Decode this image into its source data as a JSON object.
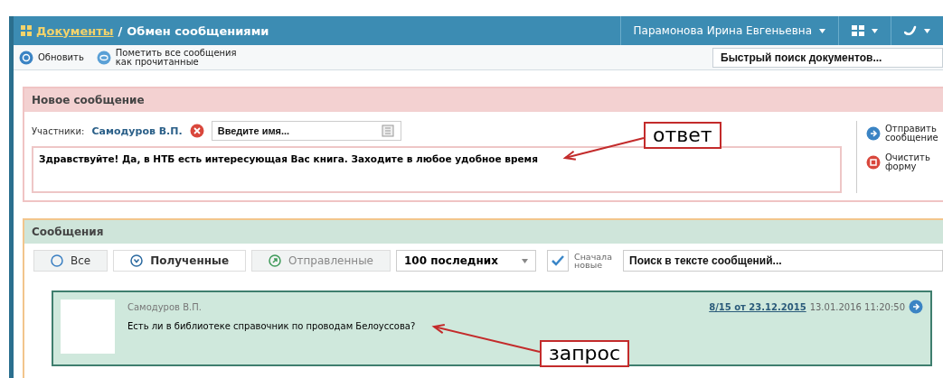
{
  "header": {
    "breadcrumb_link": "Документы",
    "separator": "/",
    "title": "Обмен сообщениями",
    "user": "Парамонова Ирина Евгеньевна"
  },
  "toolbar": {
    "refresh": "Обновить",
    "mark_read": "Пометить все сообщения\nкак прочитанные",
    "search": {
      "placeholder": "Быстрый поиск документов..."
    }
  },
  "new_message": {
    "title": "Новое сообщение",
    "participants_label": "Участники:",
    "participant": "Самодуров В.П.",
    "name_field": {
      "placeholder": "Введите имя..."
    },
    "text": "Здравствуйте! Да, в НТБ есть интересующая Вас книга. Заходите в любое удобное время",
    "send": "Отправить\nсообщение",
    "clear": "Очистить\nформу"
  },
  "messages": {
    "title": "Сообщения",
    "filters": [
      {
        "label": "Все",
        "kind": "all",
        "selected": false
      },
      {
        "label": "Полученные",
        "kind": "received",
        "selected": true
      },
      {
        "label": "Отправленные",
        "kind": "sent",
        "selected": false
      }
    ],
    "count_select": "100 последних",
    "newest_first": {
      "label": "Сначала\nновые",
      "checked": true
    },
    "search": {
      "placeholder": "Поиск в тексте сообщений..."
    },
    "items": [
      {
        "author": "Самодуров В.П.",
        "text": "Есть ли в библиотеке справочник по проводам Белоуссова?",
        "ref": "8/15 от 23.12.2015",
        "date": "13.01.2016 11:20:50"
      }
    ]
  },
  "annotations": [
    {
      "label": "ответ",
      "kind": "answer"
    },
    {
      "label": "запрос",
      "kind": "request"
    }
  ]
}
